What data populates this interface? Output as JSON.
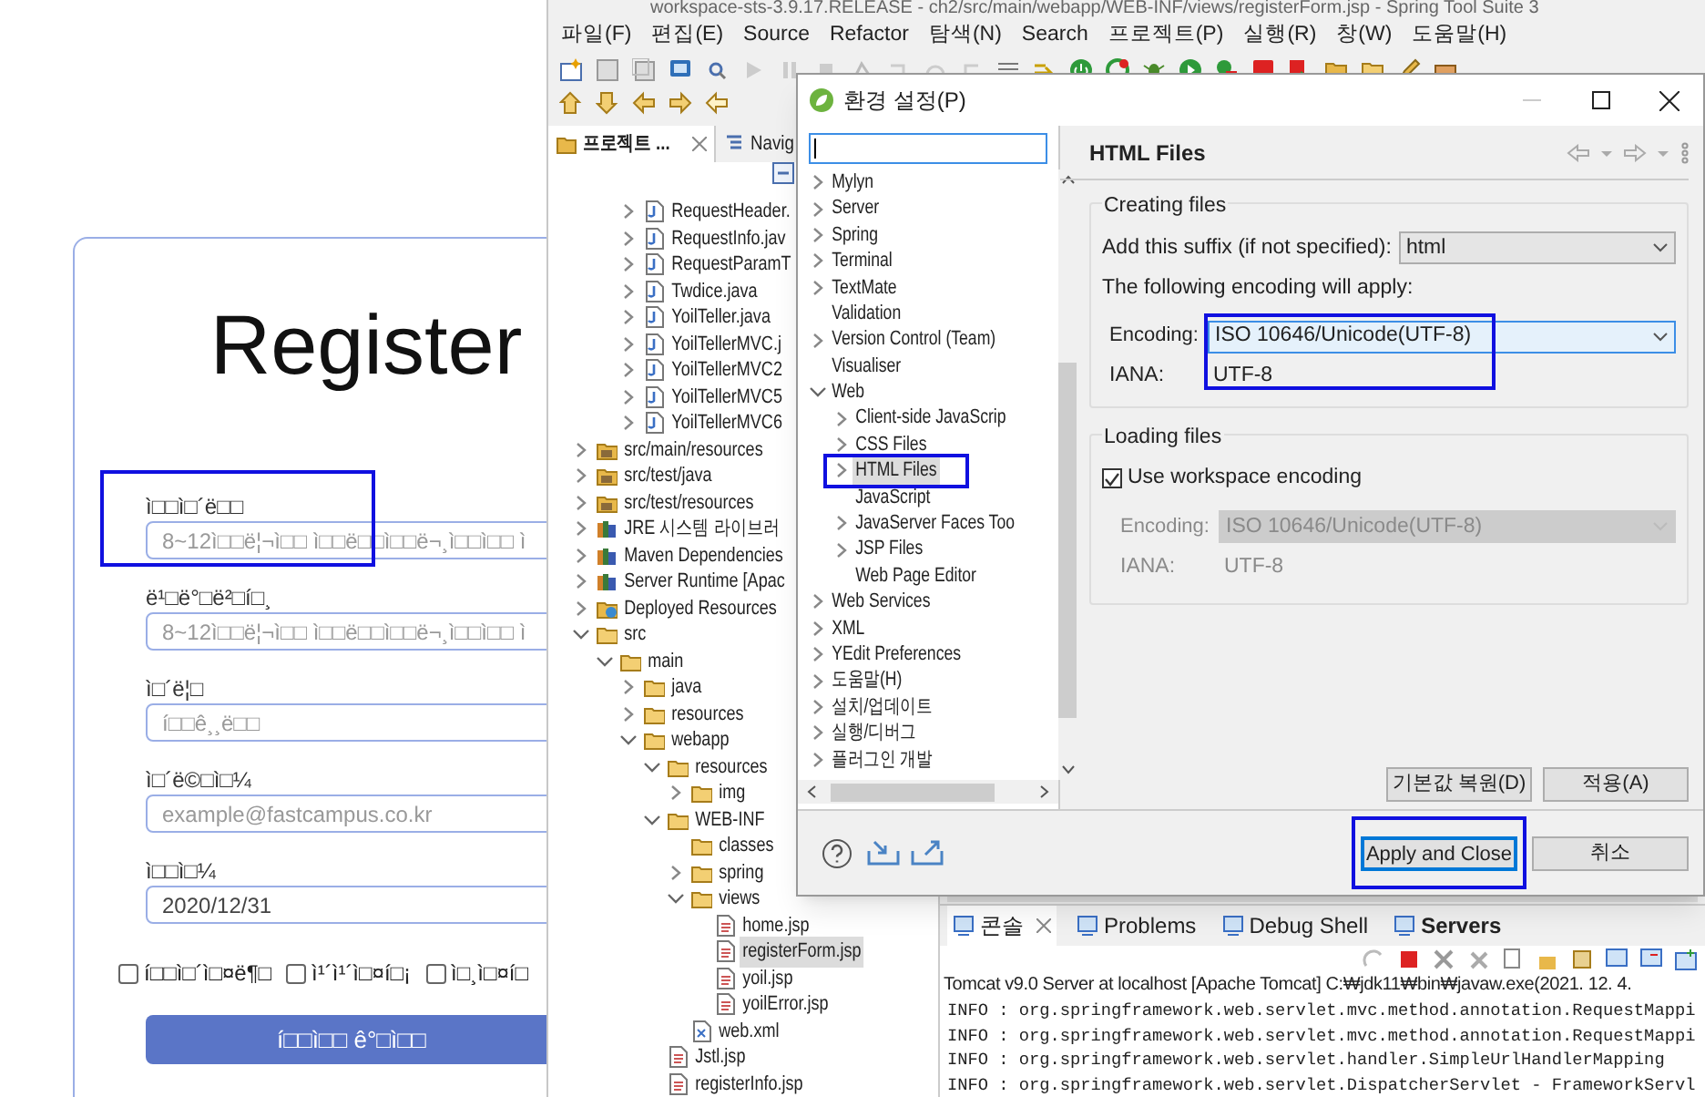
{
  "browser": {
    "heading": "Register",
    "fields": [
      {
        "label": "ì□□ì□´ë□□",
        "placeholder": "8~12ì□□ë¦¬ì□□ ì□□ë□□ì□□ë¬¸ì□□ì□□ ì",
        "highlighted": true
      },
      {
        "label": "ë¹□ë°□ë²□í□¸",
        "placeholder": "8~12ì□□ë¦¬ì□□ ì□□ë□□ì□□ë¬¸ì□□ì□□ ì",
        "highlighted": false
      },
      {
        "label": "ì□´ë¦□",
        "placeholder": "í□□ê¸¸ë□□",
        "highlighted": false
      },
      {
        "label": "ì□´ë©□ì□¼",
        "placeholder": "example@fastcampus.co.kr",
        "highlighted": false
      },
      {
        "label": "ì□□ì□¼",
        "value": "2020/12/31",
        "highlighted": false
      }
    ],
    "checkboxes": [
      {
        "label": "í□□ì□´ì□¤ë¶□",
        "checked": false
      },
      {
        "label": "ì¹´ì¹´ì□¤í□¡",
        "checked": false
      },
      {
        "label": "ì□¸ì□¤í□",
        "checked": false
      }
    ],
    "submit": "í□□ì□□ ê°□ì□□"
  },
  "ide": {
    "title": "workspace-sts-3.9.17.RELEASE - ch2/src/main/webapp/WEB-INF/views/registerForm.jsp - Spring Tool Suite 3",
    "menu": [
      "파일(F)",
      "편집(E)",
      "Source",
      "Refactor",
      "탐색(N)",
      "Search",
      "프로젝트(P)",
      "실행(R)",
      "창(W)",
      "도움말(H)"
    ],
    "explorer": {
      "tabs": [
        {
          "label": "프로젝트 ...",
          "selected": true
        },
        {
          "label": "Navig",
          "selected": false
        }
      ],
      "tree": [
        {
          "children": [
            {
              "children": [
                {
                  "label": "RequestHeader.",
                  "kind": "java",
                  "expanded": false,
                  "selected": false
                },
                {
                  "label": "RequestInfo.jav",
                  "kind": "java",
                  "expanded": false,
                  "selected": false
                },
                {
                  "label": "RequestParamT",
                  "kind": "java",
                  "expanded": false,
                  "selected": false
                },
                {
                  "label": "Twdice.java",
                  "kind": "java",
                  "expanded": false,
                  "selected": false
                },
                {
                  "label": "YoilTeller.java",
                  "kind": "java",
                  "expanded": false,
                  "selected": false
                },
                {
                  "label": "YoilTellerMVC.j",
                  "kind": "java",
                  "expanded": false,
                  "selected": false
                },
                {
                  "label": "YoilTellerMVC2",
                  "kind": "java",
                  "expanded": false,
                  "selected": false
                },
                {
                  "label": "YoilTellerMVC5",
                  "kind": "java",
                  "expanded": false,
                  "selected": false
                },
                {
                  "label": "YoilTellerMVC6",
                  "kind": "java",
                  "expanded": false,
                  "selected": false
                }
              ]
            }
          ]
        },
        {
          "label": "src/main/resources",
          "kind": "source",
          "expanded": false,
          "selected": false
        },
        {
          "label": "src/test/java",
          "kind": "source",
          "expanded": false,
          "selected": false
        },
        {
          "label": "src/test/resources",
          "kind": "source",
          "expanded": false,
          "selected": false
        },
        {
          "label": "JRE 시스템 라이브러",
          "kind": "library",
          "expanded": false,
          "selected": false
        },
        {
          "label": "Maven Dependencies",
          "kind": "library",
          "expanded": false,
          "selected": false
        },
        {
          "label": "Server Runtime [Apac",
          "kind": "library",
          "expanded": false,
          "selected": false
        },
        {
          "label": "Deployed Resources",
          "kind": "web",
          "expanded": false,
          "selected": false
        },
        {
          "label": "src",
          "kind": "folder",
          "expanded": true,
          "selected": false,
          "children": [
            {
              "label": "main",
              "kind": "folder",
              "expanded": true,
              "selected": false,
              "children": [
                {
                  "label": "java",
                  "kind": "folder",
                  "expanded": false,
                  "selected": false
                },
                {
                  "label": "resources",
                  "kind": "folder",
                  "expanded": false,
                  "selected": false
                },
                {
                  "label": "webapp",
                  "kind": "folder",
                  "expanded": true,
                  "selected": false,
                  "children": [
                    {
                      "label": "resources",
                      "kind": "folder",
                      "expanded": true,
                      "selected": false,
                      "children": [
                        {
                          "label": "img",
                          "kind": "folder",
                          "expanded": false,
                          "selected": false
                        }
                      ]
                    },
                    {
                      "label": "WEB-INF",
                      "kind": "folder",
                      "expanded": true,
                      "selected": false,
                      "children": [
                        {
                          "label": "classes",
                          "kind": "folder",
                          "selected": false
                        },
                        {
                          "label": "spring",
                          "kind": "folder",
                          "expanded": false,
                          "selected": false
                        },
                        {
                          "label": "views",
                          "kind": "folder",
                          "expanded": true,
                          "selected": false,
                          "children": [
                            {
                              "label": "home.jsp",
                              "kind": "jsp",
                              "selected": false
                            },
                            {
                              "label": "registerForm.jsp",
                              "kind": "jsp",
                              "selected": true
                            },
                            {
                              "label": "yoil.jsp",
                              "kind": "jsp",
                              "selected": false
                            },
                            {
                              "label": "yoilError.jsp",
                              "kind": "jsp",
                              "selected": false
                            }
                          ]
                        },
                        {
                          "label": "web.xml",
                          "kind": "xml",
                          "selected": false
                        }
                      ]
                    },
                    {
                      "label": "Jstl.jsp",
                      "kind": "jsp",
                      "selected": false
                    },
                    {
                      "label": "registerInfo.jsp",
                      "kind": "jsp",
                      "selected": false
                    }
                  ]
                }
              ]
            }
          ]
        }
      ]
    },
    "console": {
      "tabs": [
        {
          "label": "콘솔",
          "selected": true,
          "bold": false
        },
        {
          "label": "Problems",
          "selected": false,
          "bold": false
        },
        {
          "label": "Debug Shell",
          "selected": false,
          "bold": false
        },
        {
          "label": "Servers",
          "selected": false,
          "bold": true
        }
      ],
      "header": "Tomcat v9.0 Server at localhost [Apache Tomcat] C:₩jdk11₩bin₩javaw.exe(2021. 12. 4.",
      "lines": [
        "INFO : org.springframework.web.servlet.mvc.method.annotation.RequestMappi",
        "INFO : org.springframework.web.servlet.mvc.method.annotation.RequestMappi",
        "INFO : org.springframework.web.servlet.handler.SimpleUrlHandlerMapping",
        "INFO : org.springframework.web.servlet.DispatcherServlet - FrameworkServl"
      ]
    }
  },
  "dialog": {
    "title": "환경 설정(P)",
    "tree": [
      {
        "label": "Mylyn",
        "expanded": false,
        "selected": false,
        "highlighted": false
      },
      {
        "label": "Server",
        "expanded": false,
        "selected": false,
        "highlighted": false
      },
      {
        "label": "Spring",
        "expanded": false,
        "selected": false,
        "highlighted": false
      },
      {
        "label": "Terminal",
        "expanded": false,
        "selected": false,
        "highlighted": false
      },
      {
        "label": "TextMate",
        "expanded": false,
        "selected": false,
        "highlighted": false
      },
      {
        "label": "Validation",
        "selected": false,
        "highlighted": false
      },
      {
        "label": "Version Control (Team)",
        "expanded": false,
        "selected": false,
        "highlighted": false
      },
      {
        "label": "Visualiser",
        "selected": false,
        "highlighted": false
      },
      {
        "label": "Web",
        "expanded": true,
        "selected": false,
        "highlighted": false,
        "children": [
          {
            "label": "Client-side JavaScrip",
            "expanded": false,
            "selected": false,
            "highlighted": false
          },
          {
            "label": "CSS Files",
            "expanded": false,
            "selected": false,
            "highlighted": false
          },
          {
            "label": "HTML Files",
            "expanded": false,
            "selected": true,
            "highlighted": true
          },
          {
            "label": "JavaScript",
            "selected": false,
            "highlighted": false
          },
          {
            "label": "JavaServer Faces Too",
            "expanded": false,
            "selected": false,
            "highlighted": false
          },
          {
            "label": "JSP Files",
            "expanded": false,
            "selected": false,
            "highlighted": false
          },
          {
            "label": "Web Page Editor",
            "selected": false,
            "highlighted": false
          }
        ]
      },
      {
        "label": "Web Services",
        "expanded": false,
        "selected": false,
        "highlighted": false
      },
      {
        "label": "XML",
        "expanded": false,
        "selected": false,
        "highlighted": false
      },
      {
        "label": "YEdit Preferences",
        "expanded": false,
        "selected": false,
        "highlighted": false
      },
      {
        "label": "도움말(H)",
        "expanded": false,
        "selected": false,
        "highlighted": false
      },
      {
        "label": "설치/업데이트",
        "expanded": false,
        "selected": false,
        "highlighted": false
      },
      {
        "label": "실행/디버그",
        "expanded": false,
        "selected": false,
        "highlighted": false
      },
      {
        "label": "플러그인 개발",
        "expanded": false,
        "selected": false,
        "highlighted": false
      }
    ],
    "page_title": "HTML Files",
    "creating": {
      "legend": "Creating files",
      "suffix_label": "Add this suffix (if not specified):",
      "suffix": "html",
      "note": "The following encoding will apply:",
      "encoding_label": "Encoding:",
      "encoding": "ISO 10646/Unicode(UTF-8)",
      "iana_label": "IANA:",
      "iana": "UTF-8",
      "highlighted": true
    },
    "loading": {
      "legend": "Loading files",
      "checkbox": {
        "label": "Use workspace encoding",
        "checked": true
      },
      "encoding_label": "Encoding:",
      "encoding": "ISO 10646/Unicode(UTF-8)",
      "iana_label": "IANA:",
      "iana": "UTF-8"
    },
    "page_buttons": [
      "기본값 복원(D)",
      "적용(A)"
    ],
    "buttons": [
      {
        "label": "Apply and Close",
        "highlighted": true
      },
      {
        "label": "취소",
        "highlighted": false
      }
    ]
  }
}
